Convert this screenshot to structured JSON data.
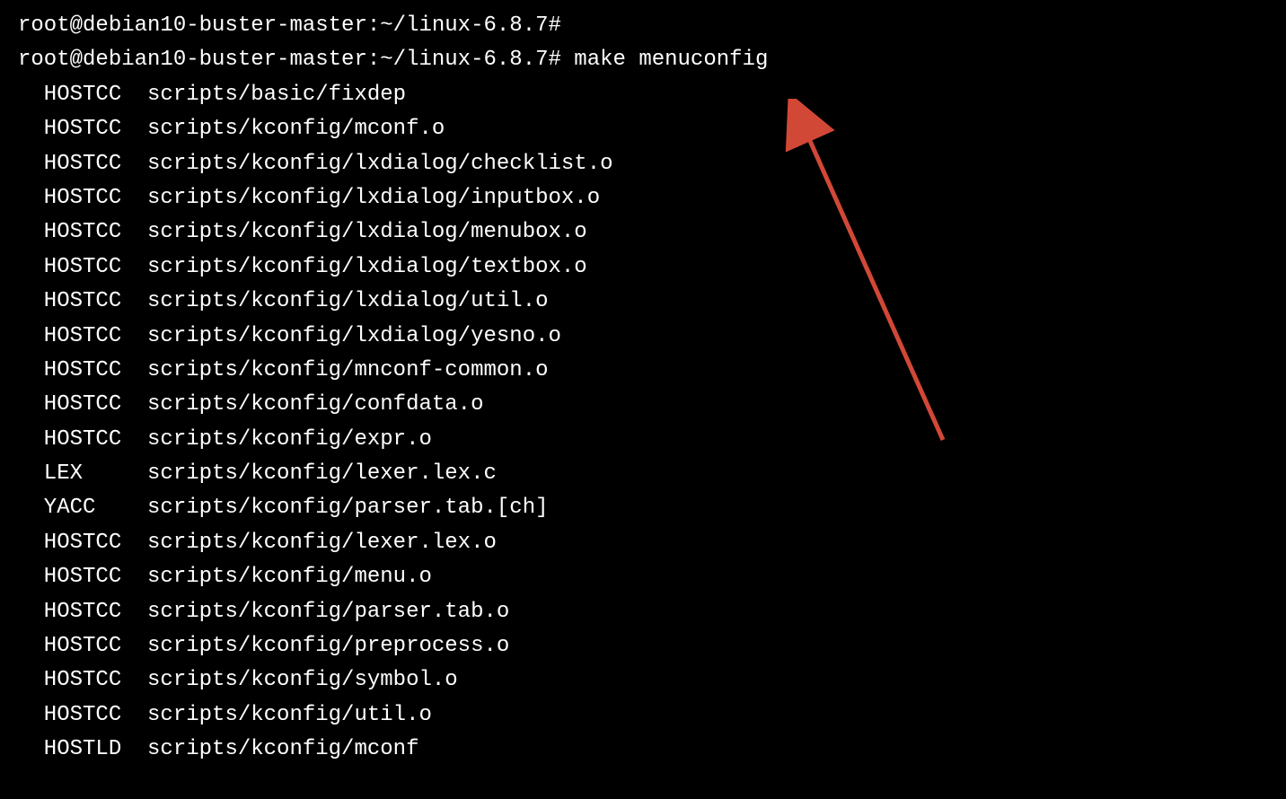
{
  "prompt": "root@debian10-buster-master:~/linux-6.8.7#",
  "command_empty": " ",
  "command": " make menuconfig",
  "output_lines": [
    {
      "tool": "HOSTCC",
      "file": "scripts/basic/fixdep"
    },
    {
      "tool": "HOSTCC",
      "file": "scripts/kconfig/mconf.o"
    },
    {
      "tool": "HOSTCC",
      "file": "scripts/kconfig/lxdialog/checklist.o"
    },
    {
      "tool": "HOSTCC",
      "file": "scripts/kconfig/lxdialog/inputbox.o"
    },
    {
      "tool": "HOSTCC",
      "file": "scripts/kconfig/lxdialog/menubox.o"
    },
    {
      "tool": "HOSTCC",
      "file": "scripts/kconfig/lxdialog/textbox.o"
    },
    {
      "tool": "HOSTCC",
      "file": "scripts/kconfig/lxdialog/util.o"
    },
    {
      "tool": "HOSTCC",
      "file": "scripts/kconfig/lxdialog/yesno.o"
    },
    {
      "tool": "HOSTCC",
      "file": "scripts/kconfig/mnconf-common.o"
    },
    {
      "tool": "HOSTCC",
      "file": "scripts/kconfig/confdata.o"
    },
    {
      "tool": "HOSTCC",
      "file": "scripts/kconfig/expr.o"
    },
    {
      "tool": "LEX",
      "file": "scripts/kconfig/lexer.lex.c"
    },
    {
      "tool": "YACC",
      "file": "scripts/kconfig/parser.tab.[ch]"
    },
    {
      "tool": "HOSTCC",
      "file": "scripts/kconfig/lexer.lex.o"
    },
    {
      "tool": "HOSTCC",
      "file": "scripts/kconfig/menu.o"
    },
    {
      "tool": "HOSTCC",
      "file": "scripts/kconfig/parser.tab.o"
    },
    {
      "tool": "HOSTCC",
      "file": "scripts/kconfig/preprocess.o"
    },
    {
      "tool": "HOSTCC",
      "file": "scripts/kconfig/symbol.o"
    },
    {
      "tool": "HOSTCC",
      "file": "scripts/kconfig/util.o"
    },
    {
      "tool": "HOSTLD",
      "file": "scripts/kconfig/mconf"
    }
  ],
  "annotation": {
    "type": "arrow",
    "color": "#d14836"
  }
}
